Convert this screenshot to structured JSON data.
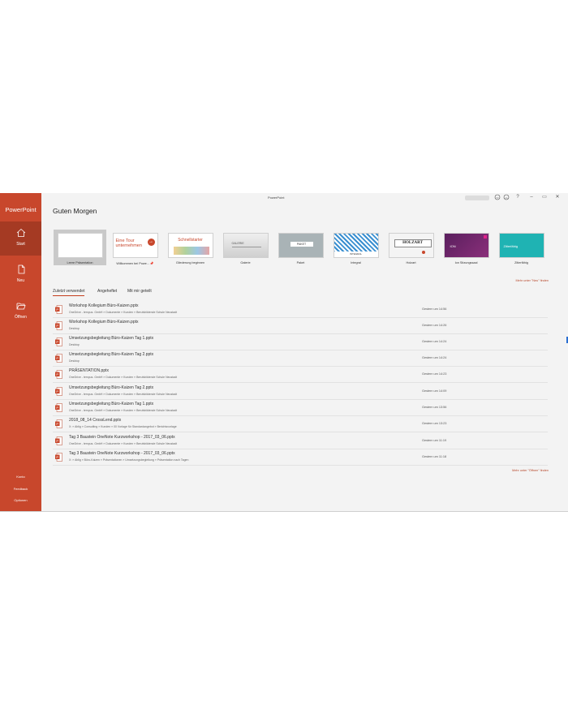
{
  "app": {
    "name": "PowerPoint",
    "window_title": "PowerPoint"
  },
  "sidebar": {
    "items": [
      {
        "label": "Start",
        "icon": "home-icon"
      },
      {
        "label": "Neu",
        "icon": "new-document-icon"
      },
      {
        "label": "Öffnen",
        "icon": "folder-open-icon"
      }
    ],
    "bottom": [
      {
        "label": "Konto"
      },
      {
        "label": "Feedback"
      },
      {
        "label": "Optionen"
      }
    ]
  },
  "titlebar": {
    "controls": [
      "smiley-icon",
      "frown-icon",
      "help-icon",
      "minimize-icon",
      "restore-icon",
      "close-icon"
    ],
    "help": "?",
    "minimize": "–",
    "restore": "▭",
    "close": "✕"
  },
  "main": {
    "greeting": "Guten Morgen",
    "templates": [
      {
        "label": "Leere Präsentation"
      },
      {
        "label": "Willkommen bei Powe...",
        "thumb_text": "Eine Tour unternehmen"
      },
      {
        "label": "Gliederung beginnen",
        "thumb_text": "Schnellstarter"
      },
      {
        "label": "Galerie",
        "thumb_text": "GALERIE"
      },
      {
        "label": "Paket",
        "thumb_text": "PAKET"
      },
      {
        "label": "Integral",
        "thumb_text": "INTEGRAL"
      },
      {
        "label": "Holzart",
        "thumb_text": "HOLZART"
      },
      {
        "label": "Ion Sitzungssaal",
        "thumb_text": "ION"
      },
      {
        "label": "Zitierfähig",
        "thumb_text": "Zitierfähig"
      }
    ],
    "more_templates": "Mehr unter \"Neu\" finden",
    "tabs": [
      {
        "label": "Zuletzt verwendet"
      },
      {
        "label": "Angeheftet"
      },
      {
        "label": "Mit mir geteilt"
      }
    ],
    "files": [
      {
        "name": "Workshop Kollegium Büro-Kaizen.pptx",
        "path": "OneDrive - tempus. GmbH » Dokumente » Kunden » Berufsbildende Schule Neustadt",
        "time": "Gestern um 14:56"
      },
      {
        "name": "Workshop Kollegium Büro-Kaizen.pptx",
        "path": "Desktop",
        "time": "Gestern um 14:26"
      },
      {
        "name": "Umsetzungsbegleitung Büro-Kaizen Tag 1.pptx",
        "path": "Desktop",
        "time": "Gestern um 14:24"
      },
      {
        "name": "Umsetzungsbegleitung Büro-Kaizen Tag 2.pptx",
        "path": "Desktop",
        "time": "Gestern um 14:24"
      },
      {
        "name": "PRÄSENTATION.pptx",
        "path": "OneDrive - tempus. GmbH » Dokumente » Kunden » Berufsbildende Schule Neustadt",
        "time": "Gestern um 14:23"
      },
      {
        "name": "Umsetzungsbegleitung Büro-Kaizen Tag 2.pptx",
        "path": "OneDrive - tempus. GmbH » Dokumente » Kunden » Berufsbildende Schule Neustadt",
        "time": "Gestern um 14:09"
      },
      {
        "name": "Umsetzungsbegleitung Büro-Kaizen Tag 1.pptx",
        "path": "OneDrive - tempus. GmbH » Dokumente » Kunden » Berufsbildende Schule Neustadt",
        "time": "Gestern um 13:56"
      },
      {
        "name": "2018_08_14 CrossLend.pptx",
        "path": "X: » Ablig » Consulting » Kunden » 00 Vorlage für Standardangebot » Berichtsvorlage",
        "time": "Gestern um 13:23"
      },
      {
        "name": "Tag 3 Baustein OneNote Kurzworkshop - 2017_03_06.pptx",
        "path": "OneDrive - tempus. GmbH » Dokumente » Kunden » Berufsbildende Schule Neustadt",
        "time": "Gestern um 11:19"
      },
      {
        "name": "Tag 3 Baustein OneNote Kurzworkshop - 2017_03_06.pptx",
        "path": "X: » Ablig » Büro-Kaizen » Präsentationen » Umsetzungsbegleitung » Präsentation nach Tagen",
        "time": "Gestern um 11:18"
      }
    ],
    "more_files": "Mehr unter \"Öffnen\" finden"
  },
  "colors": {
    "accent": "#c8472c",
    "accent_dark": "#a53a23",
    "background": "#f3f3f3"
  }
}
